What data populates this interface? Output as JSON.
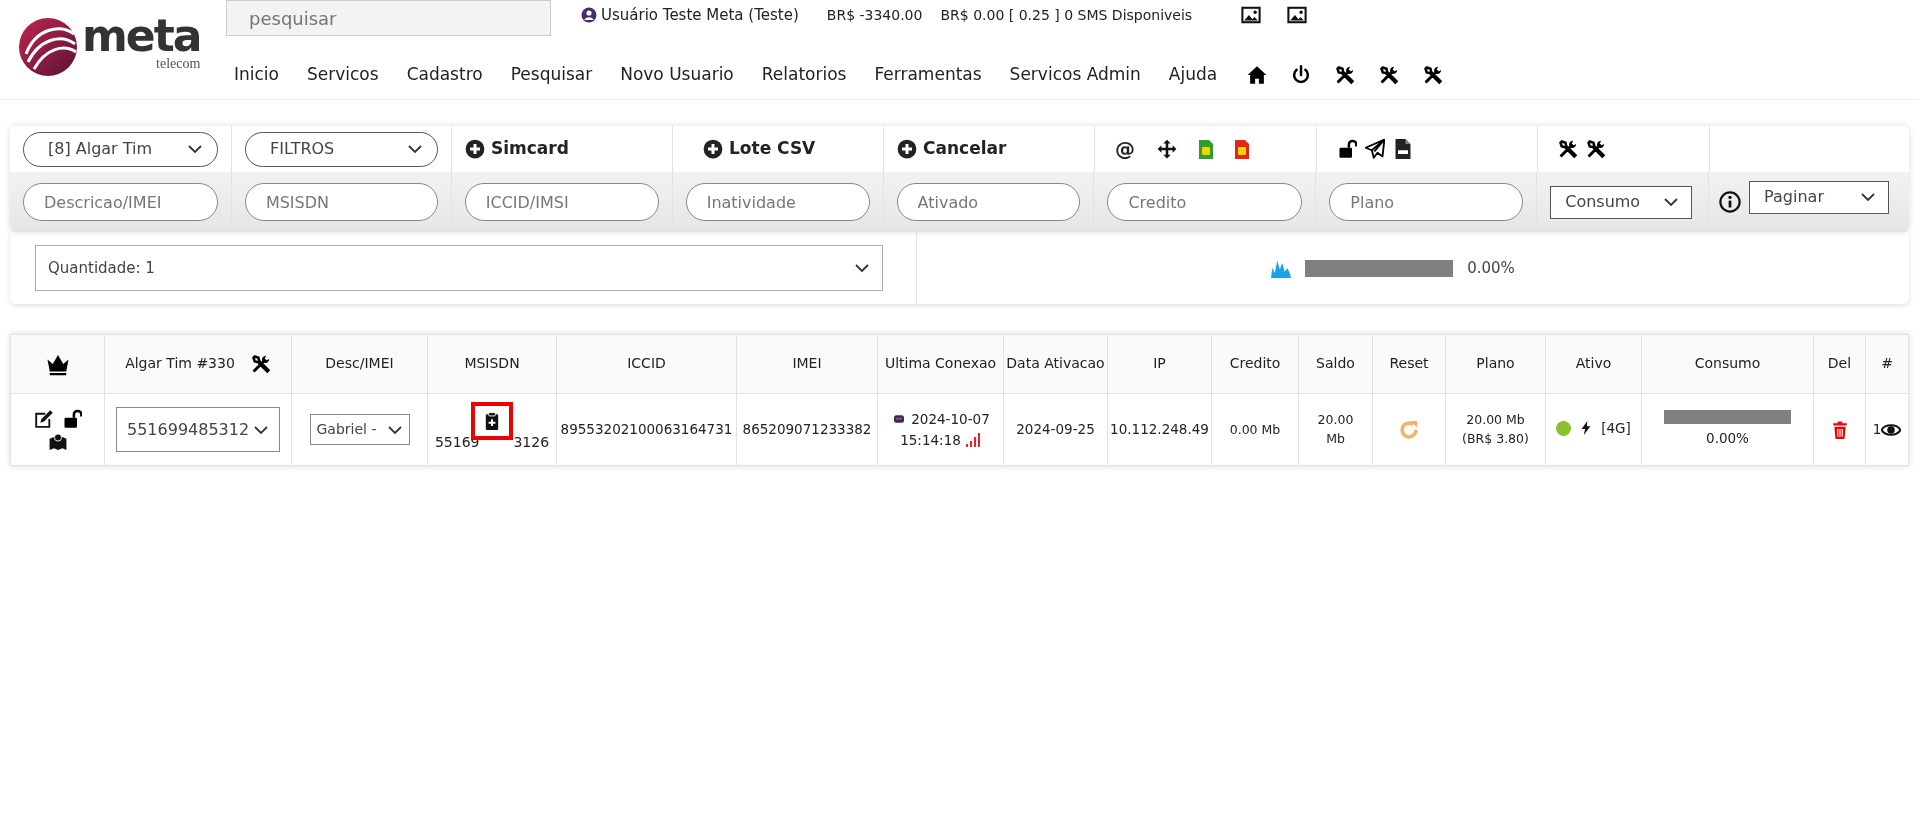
{
  "header": {
    "logo": {
      "word": "meta",
      "sub": "telecom"
    },
    "search": {
      "placeholder": "pesquisar"
    },
    "user": "Usuário Teste Meta (Teste)",
    "balance": "BR$ -3340.00",
    "sms": "BR$ 0.00 [ 0.25 ] 0 SMS Disponiveis",
    "top_icons": [
      {
        "kind": "image"
      },
      {
        "kind": "image"
      }
    ],
    "nav": [
      "Inicio",
      "Servicos",
      "Cadastro",
      "Pesquisar",
      "Novo Usuario",
      "Relatorios",
      "Ferramentas",
      "Servicos Admin",
      "Ajuda"
    ],
    "nav_icons": [
      {
        "kind": "home"
      },
      {
        "kind": "power"
      },
      {
        "kind": "tools"
      },
      {
        "kind": "tools"
      },
      {
        "kind": "tools"
      }
    ]
  },
  "toolbar": {
    "selects": [
      "[8] Algar Tim",
      "FILTROS"
    ],
    "actions": [
      "Simcard",
      "Lote CSV",
      "Cancelar"
    ],
    "icon_groups": [
      [
        {
          "kind": "glyph",
          "text": "@"
        },
        {
          "kind": "move"
        },
        {
          "kind": "sim",
          "color": "#2e9e2e"
        },
        {
          "kind": "sim",
          "color": "#e8231a"
        }
      ],
      [
        {
          "kind": "lock-open"
        },
        {
          "kind": "send"
        },
        {
          "kind": "csv-file"
        }
      ],
      [
        {
          "kind": "tools"
        },
        {
          "kind": "tools"
        }
      ]
    ],
    "filters": [
      {
        "kind": "input",
        "placeholder": "Descricao/IMEI"
      },
      {
        "kind": "input",
        "placeholder": "MSISDN"
      },
      {
        "kind": "input",
        "placeholder": "ICCID/IMSI"
      },
      {
        "kind": "input",
        "placeholder": "Inatividade"
      },
      {
        "kind": "input",
        "placeholder": "Ativado"
      },
      {
        "kind": "input",
        "placeholder": "Credito"
      },
      {
        "kind": "input",
        "placeholder": "Plano"
      },
      {
        "kind": "select",
        "value": "Consumo"
      },
      {
        "kind": "select",
        "value": "Paginar",
        "info": true
      }
    ]
  },
  "summary": {
    "quantity": "Quantidade: 1",
    "usage": {
      "level": 0,
      "reading": "0.00%"
    }
  },
  "table": {
    "columns": [
      "",
      "Algar Tim #330",
      "Desc/IMEI",
      "MSISDN",
      "ICCID",
      "IMEI",
      "Ultima Conexao",
      "Data Ativacao",
      "IP",
      "Credito",
      "Saldo",
      "Reset",
      "Plano",
      "Ativo",
      "Consumo",
      "Del",
      "#"
    ],
    "rows": [
      {
        "line": "551699485312",
        "desc": "Gabriel -",
        "msisdn_start": "55169",
        "msisdn_end": "3126",
        "msisdn_flagged": true,
        "iccid": "89553202100063164731",
        "imei": "865209071233382",
        "last_date": "2024-10-07",
        "last_time": "15:14:18",
        "activated": "2024-09-25",
        "ip": "10.112.248.49",
        "credit": "0.00 Mb",
        "balance": "20.00 Mb",
        "plan": "20.00 Mb",
        "plan_price": "(BR$ 3.80)",
        "active": true,
        "network": "[4G]",
        "consumo": {
          "level": 0,
          "reading": "0.00%"
        },
        "index": "1"
      }
    ]
  }
}
